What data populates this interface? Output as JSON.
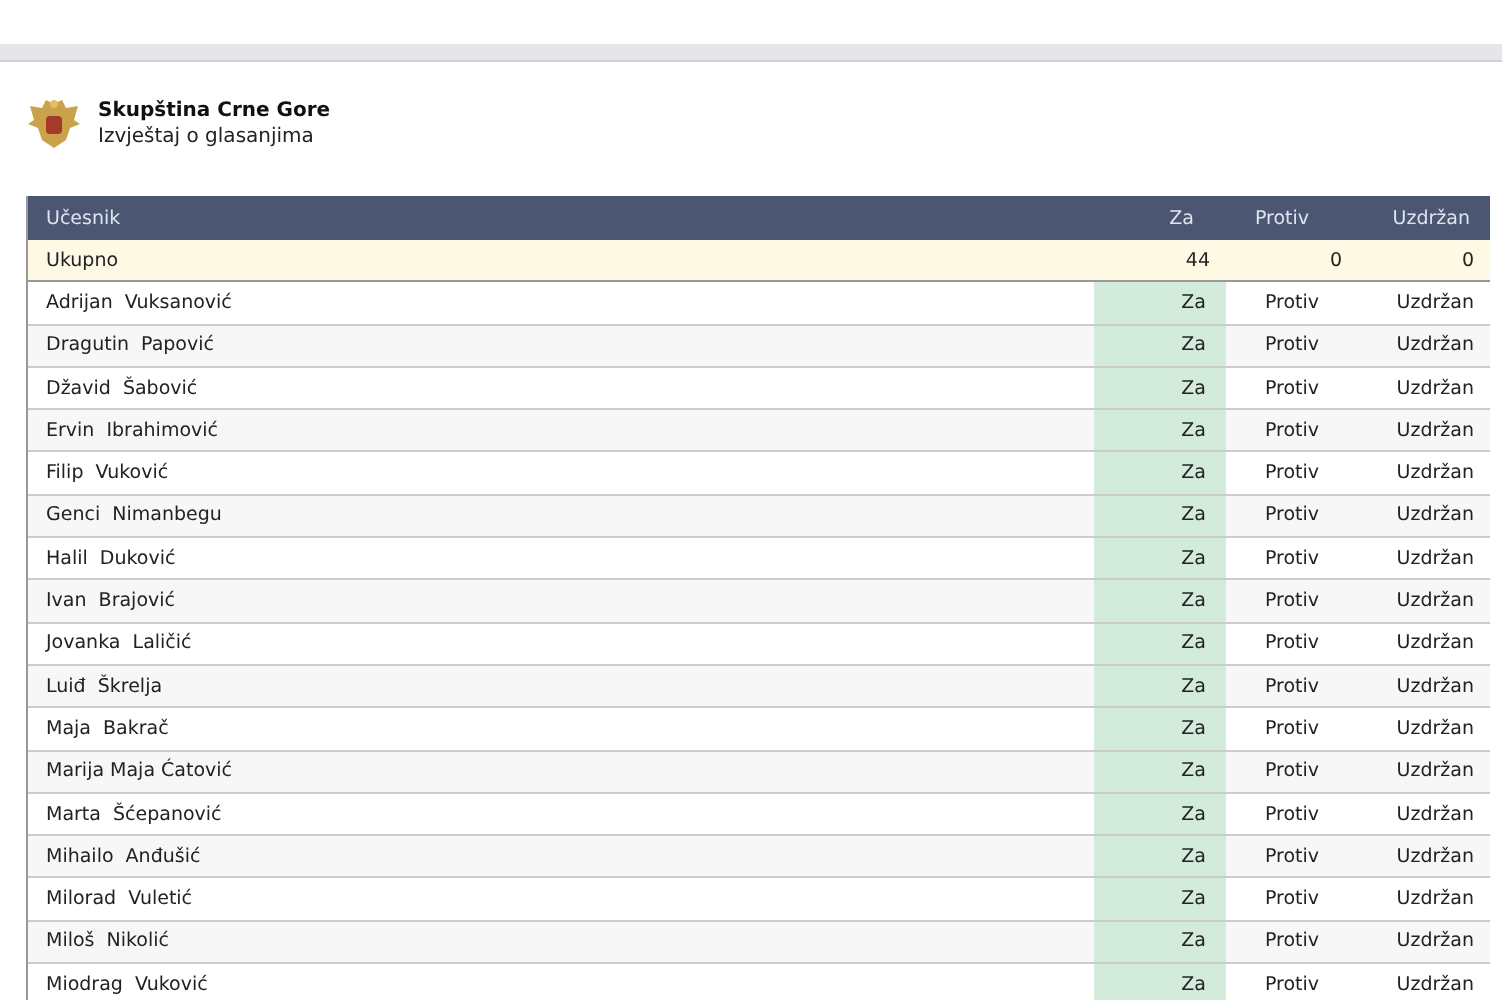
{
  "header": {
    "title": "Skupština Crne Gore",
    "subtitle": "Izvještaj o glasanjima"
  },
  "table": {
    "columns": [
      "Učesnik",
      "Za",
      "Protiv",
      "Uzdržan"
    ],
    "total": {
      "label": "Ukupno",
      "values": [
        "44",
        "0",
        "0"
      ]
    },
    "rows": [
      {
        "name": "Adrijan  Vuksanović",
        "options": [
          {
            "label": "Za",
            "selected": true
          },
          {
            "label": "Protiv",
            "selected": false
          },
          {
            "label": "Uzdržan",
            "selected": false
          }
        ]
      },
      {
        "name": "Dragutin  Papović",
        "options": [
          {
            "label": "Za",
            "selected": true
          },
          {
            "label": "Protiv",
            "selected": false
          },
          {
            "label": "Uzdržan",
            "selected": false
          }
        ]
      },
      {
        "name": "Džavid  Šabović",
        "options": [
          {
            "label": "Za",
            "selected": true
          },
          {
            "label": "Protiv",
            "selected": false
          },
          {
            "label": "Uzdržan",
            "selected": false
          }
        ]
      },
      {
        "name": "Ervin  Ibrahimović",
        "options": [
          {
            "label": "Za",
            "selected": true
          },
          {
            "label": "Protiv",
            "selected": false
          },
          {
            "label": "Uzdržan",
            "selected": false
          }
        ]
      },
      {
        "name": "Filip  Vuković",
        "options": [
          {
            "label": "Za",
            "selected": true
          },
          {
            "label": "Protiv",
            "selected": false
          },
          {
            "label": "Uzdržan",
            "selected": false
          }
        ]
      },
      {
        "name": "Genci  Nimanbegu",
        "options": [
          {
            "label": "Za",
            "selected": true
          },
          {
            "label": "Protiv",
            "selected": false
          },
          {
            "label": "Uzdržan",
            "selected": false
          }
        ]
      },
      {
        "name": "Halil  Duković",
        "options": [
          {
            "label": "Za",
            "selected": true
          },
          {
            "label": "Protiv",
            "selected": false
          },
          {
            "label": "Uzdržan",
            "selected": false
          }
        ]
      },
      {
        "name": "Ivan  Brajović",
        "options": [
          {
            "label": "Za",
            "selected": true
          },
          {
            "label": "Protiv",
            "selected": false
          },
          {
            "label": "Uzdržan",
            "selected": false
          }
        ]
      },
      {
        "name": "Jovanka  Laličić",
        "options": [
          {
            "label": "Za",
            "selected": true
          },
          {
            "label": "Protiv",
            "selected": false
          },
          {
            "label": "Uzdržan",
            "selected": false
          }
        ]
      },
      {
        "name": "Luiđ  Škrelja",
        "options": [
          {
            "label": "Za",
            "selected": true
          },
          {
            "label": "Protiv",
            "selected": false
          },
          {
            "label": "Uzdržan",
            "selected": false
          }
        ]
      },
      {
        "name": "Maja  Bakrač",
        "options": [
          {
            "label": "Za",
            "selected": true
          },
          {
            "label": "Protiv",
            "selected": false
          },
          {
            "label": "Uzdržan",
            "selected": false
          }
        ]
      },
      {
        "name": "Marija Maja Ćatović",
        "options": [
          {
            "label": "Za",
            "selected": true
          },
          {
            "label": "Protiv",
            "selected": false
          },
          {
            "label": "Uzdržan",
            "selected": false
          }
        ]
      },
      {
        "name": "Marta  Šćepanović",
        "options": [
          {
            "label": "Za",
            "selected": true
          },
          {
            "label": "Protiv",
            "selected": false
          },
          {
            "label": "Uzdržan",
            "selected": false
          }
        ]
      },
      {
        "name": "Mihailo  Anđušić",
        "options": [
          {
            "label": "Za",
            "selected": true
          },
          {
            "label": "Protiv",
            "selected": false
          },
          {
            "label": "Uzdržan",
            "selected": false
          }
        ]
      },
      {
        "name": "Milorad  Vuletić",
        "options": [
          {
            "label": "Za",
            "selected": true
          },
          {
            "label": "Protiv",
            "selected": false
          },
          {
            "label": "Uzdržan",
            "selected": false
          }
        ]
      },
      {
        "name": "Miloš  Nikolić",
        "options": [
          {
            "label": "Za",
            "selected": true
          },
          {
            "label": "Protiv",
            "selected": false
          },
          {
            "label": "Uzdržan",
            "selected": false
          }
        ]
      },
      {
        "name": "Miodrag  Vuković",
        "options": [
          {
            "label": "Za",
            "selected": true
          },
          {
            "label": "Protiv",
            "selected": false
          },
          {
            "label": "Uzdržan",
            "selected": false
          }
        ]
      }
    ]
  }
}
